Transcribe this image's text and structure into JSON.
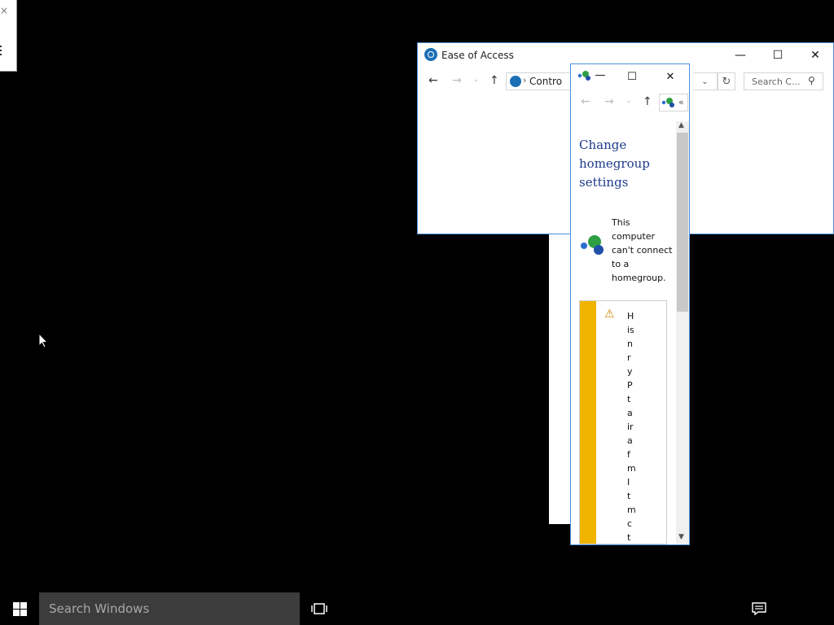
{
  "top_left_dialog": {
    "close_glyph": "×"
  },
  "ease_window": {
    "title": "Ease of Access",
    "address_text": "Contro",
    "search_placeholder": "Search C...",
    "minimize": "—",
    "maximize": "☐",
    "close": "✕"
  },
  "homegroup_window": {
    "title_min": "—",
    "title_max": "☐",
    "title_close": "✕",
    "address_chevron": "«",
    "heading": "Change homegroup settings",
    "status": "This computer can't connect to a homegroup.",
    "warning_text": "H\nis\nn\nr\ny\nP\nt\na\nir\na\nf\nm\nI\nt\nm\nc\nt"
  },
  "taskbar": {
    "search_placeholder": "Search Windows"
  },
  "colors": {
    "accent": "#1b6fb6",
    "warning": "#f0b400",
    "heading": "#1e3a8a"
  }
}
